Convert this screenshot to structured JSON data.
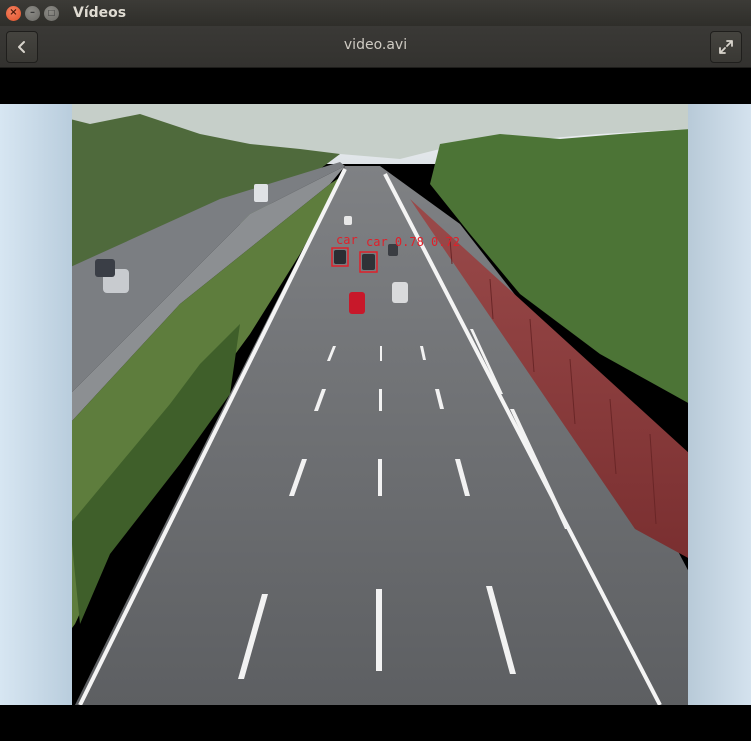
{
  "window": {
    "app_title": "Vídeos",
    "close_glyph": "×",
    "minimize_glyph": "–",
    "maximize_glyph": "□"
  },
  "header": {
    "file_name": "video.avi",
    "back_icon": "chevron-left-icon",
    "fullscreen_icon": "fullscreen-expand-icon"
  },
  "video": {
    "detections": [
      {
        "label": "car",
        "score": "0.78",
        "color": "#e0202a"
      },
      {
        "label": "car",
        "score": "0.72",
        "color": "#e0202a"
      }
    ],
    "detection_text_1": "car",
    "detection_text_2": "car 0.78 0.72"
  },
  "colors": {
    "titlebar": "#3c3b37",
    "close_button": "#e9592f",
    "letterbox": "#000000",
    "detection_box": "#e0202a",
    "noise_barrier": "#8a3a3a"
  }
}
